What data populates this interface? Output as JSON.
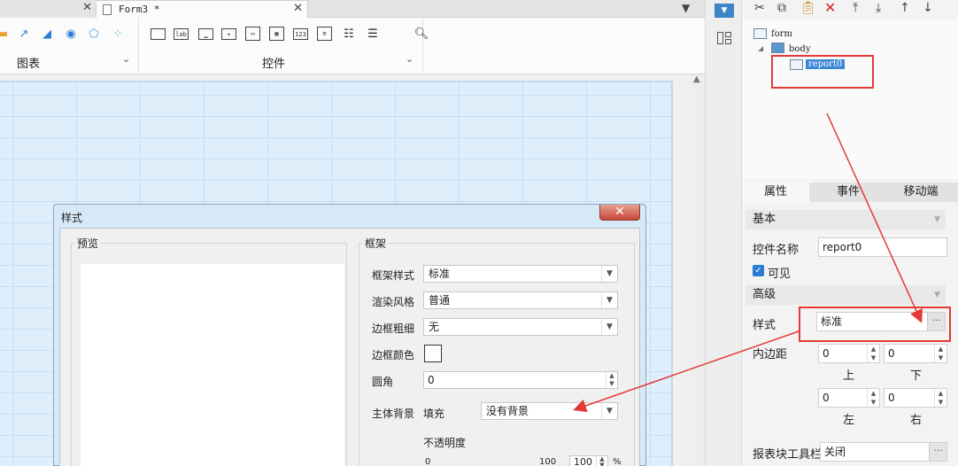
{
  "tabs": {
    "active_label": "Form3 *"
  },
  "ribbon": {
    "chart_group_label": "图表",
    "control_group_label": "控件",
    "control_icon_labels": {
      "label": "lab",
      "number": "123"
    }
  },
  "dialog": {
    "title": "样式",
    "preview_title": "预览",
    "frame_title": "框架",
    "frame_style_label": "框架样式",
    "frame_style_value": "标准",
    "render_style_label": "渲染风格",
    "render_style_value": "普通",
    "border_width_label": "边框粗细",
    "border_width_value": "无",
    "border_color_label": "边框颜色",
    "corner_label": "圆角",
    "corner_value": "0",
    "body_bg_label": "主体背景",
    "fill_label": "填充",
    "bg_value": "没有背景",
    "opacity_label": "不透明度",
    "opacity_min": "0",
    "opacity_max": "100",
    "opacity_value": "100",
    "percent_sign": "%"
  },
  "tree": {
    "form": "form",
    "body": "body",
    "report": "report0"
  },
  "props": {
    "tabs": [
      "属性",
      "事件",
      "移动端"
    ],
    "basic_section": "基本",
    "widget_name_label": "控件名称",
    "widget_name_value": "report0",
    "visible_label": "可见",
    "advanced_section": "高级",
    "style_label": "样式",
    "style_value": "标准",
    "padding_label": "内边距",
    "padding_top": "0",
    "padding_bottom": "0",
    "padding_left": "0",
    "padding_right": "0",
    "top_label": "上",
    "bottom_label": "下",
    "left_label": "左",
    "right_label": "右",
    "toolbar_label": "报表块工具栏",
    "toolbar_value": "关闭"
  },
  "colors": {
    "accent": "#3b86d6",
    "annotation_red": "#e53935",
    "canvas": "#deeefb"
  }
}
